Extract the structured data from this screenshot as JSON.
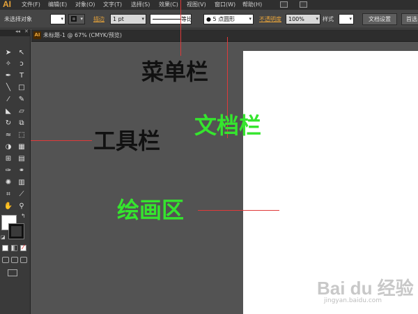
{
  "app": {
    "logo": "AI"
  },
  "menus": [
    "文件(F)",
    "编辑(E)",
    "对象(O)",
    "文字(T)",
    "选择(S)",
    "效果(C)",
    "视图(V)",
    "窗口(W)",
    "帮助(H)"
  ],
  "control_bar": {
    "selection_status": "未选择对象",
    "stroke_label": "描边",
    "stroke_weight": "1 pt",
    "profile_label": "等比",
    "brush_value": "5 点圆形",
    "opacity_label": "不透明度",
    "opacity_value": "100%",
    "style_label": "样式",
    "document_setup_button": "文档设置",
    "preferences_button": "首选"
  },
  "document_tab": {
    "title": "未标题-1 @ 67% (CMYK/预览)"
  },
  "annotations": {
    "menu_bar": "菜单栏",
    "document_bar": "文档栏",
    "toolbar": "工具栏",
    "drawing_area": "绘画区"
  },
  "annotation_colors": {
    "black": "#111111",
    "green": "#35e52e",
    "line": "#e03a3a"
  },
  "watermark": {
    "brand": "Bai du 经验",
    "url": "jingyan.baidu.com"
  }
}
